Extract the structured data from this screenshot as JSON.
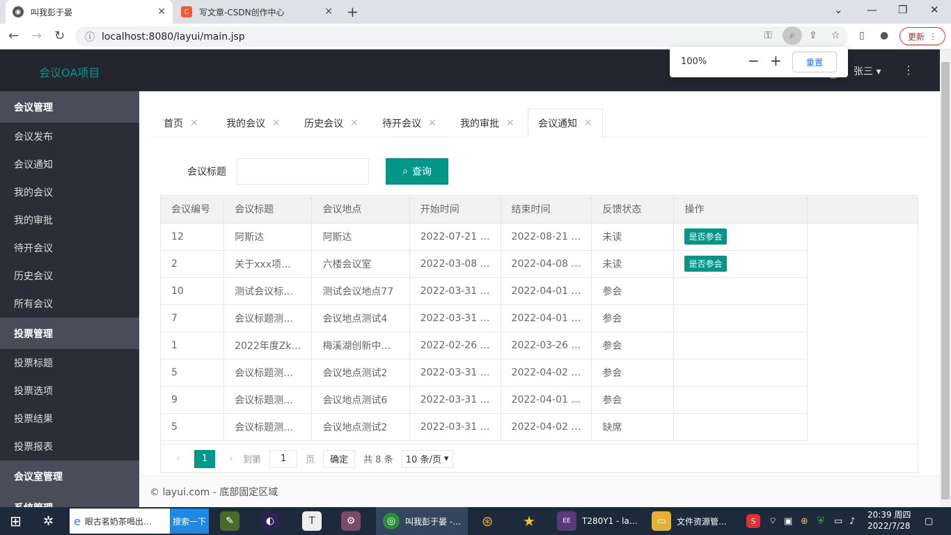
{
  "browser": {
    "tabs": [
      {
        "title": "叫我彭于晏",
        "active": true
      },
      {
        "title": "写文章-CSDN创作中心",
        "active": false
      }
    ],
    "url": "localhost:8080/layui/main.jsp",
    "update_label": "更新",
    "zoom": {
      "percent": "100%",
      "reset_label": "重置"
    }
  },
  "header": {
    "logo": "会议OA项目",
    "user_name": "张三"
  },
  "sidebar": {
    "sections": [
      {
        "title": "会议管理",
        "items": [
          "会议发布",
          "会议通知",
          "我的会议",
          "我的审批",
          "待开会议",
          "历史会议",
          "所有会议"
        ]
      },
      {
        "title": "投票管理",
        "items": [
          "投票标题",
          "投票选项",
          "投票结果",
          "投票报表"
        ]
      },
      {
        "title": "会议室管理",
        "items": []
      },
      {
        "title": "系统管理",
        "items": []
      }
    ]
  },
  "page_tabs": [
    "首页",
    "我的会议",
    "历史会议",
    "待开会议",
    "我的审批",
    "会议通知"
  ],
  "search": {
    "label": "会议标题",
    "value": "",
    "button_label": "查询"
  },
  "table": {
    "columns": [
      "会议编号",
      "会议标题",
      "会议地点",
      "开始时间",
      "结束时间",
      "反馈状态",
      "操作"
    ],
    "rows": [
      [
        "12",
        "阿斯达",
        "阿斯达",
        "2022-07-21 …",
        "2022-08-21 …",
        "未读",
        "是否参会"
      ],
      [
        "2",
        "关于xxx项…",
        "六楼会议室",
        "2022-03-08 …",
        "2022-04-08 …",
        "未读",
        "是否参会"
      ],
      [
        "10",
        "测试会议标…",
        "测试会议地点77",
        "2022-03-31 …",
        "2022-04-01 …",
        "参会",
        ""
      ],
      [
        "7",
        "会议标题测…",
        "会议地点测试4",
        "2022-03-31 …",
        "2022-04-01 …",
        "参会",
        ""
      ],
      [
        "1",
        "2022年度Zk…",
        "梅溪湖创新中…",
        "2022-02-26 …",
        "2022-03-26 …",
        "参会",
        ""
      ],
      [
        "5",
        "会议标题测…",
        "会议地点测试2",
        "2022-03-31 …",
        "2022-04-02 …",
        "参会",
        ""
      ],
      [
        "9",
        "会议标题测…",
        "会议地点测试6",
        "2022-03-31 …",
        "2022-04-01 …",
        "参会",
        ""
      ],
      [
        "5",
        "会议标题测…",
        "会议地点测试2",
        "2022-03-31 …",
        "2022-04-02 …",
        "缺席",
        ""
      ]
    ]
  },
  "pager": {
    "current_page": "1",
    "goto_label": "到第",
    "goto_value": "1",
    "page_unit": "页",
    "confirm_label": "确定",
    "total_label": "共 8 条",
    "page_size": "10 条/页"
  },
  "footer": {
    "text": "© layui.com - 底部固定区域"
  },
  "taskbar": {
    "search_text": "眼古茗奶茶喝出…",
    "search_button": "搜索一下",
    "apps": [
      "叫我彭于晏 -…",
      "T280Y1 - la…",
      "文件资源管…"
    ],
    "time": "20:39 周四",
    "date": "2022/7/28"
  }
}
